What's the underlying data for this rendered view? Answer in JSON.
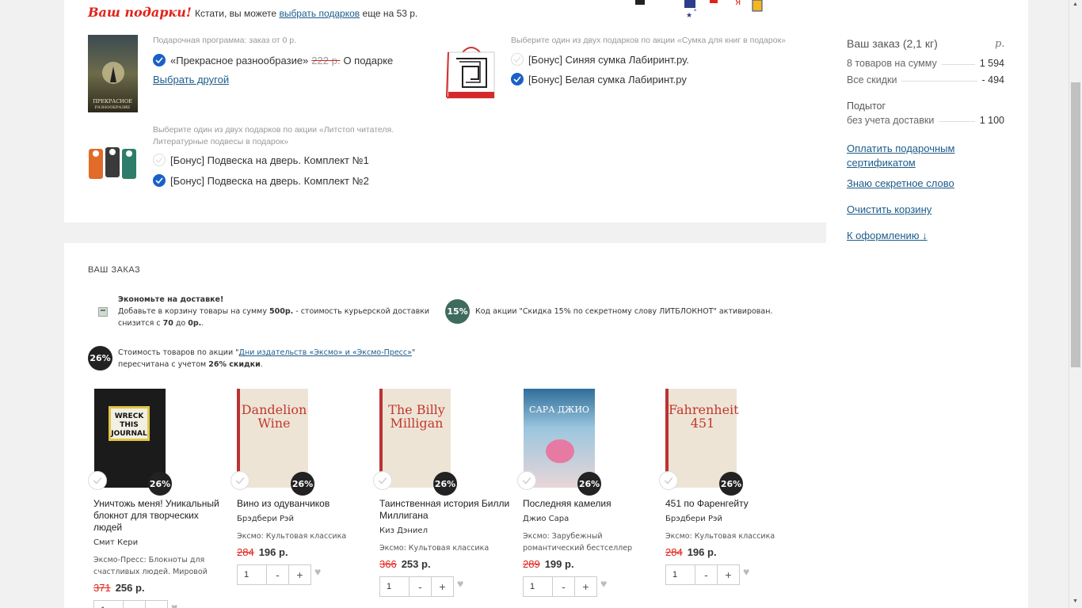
{
  "gifts": {
    "title": "Ваш подарки!",
    "note_prefix": "Кстати, вы можете",
    "note_link": "выбрать подарков",
    "note_suffix": "еще на 53 р.",
    "program": {
      "caption": "Подарочная программа: заказ от 0 р.",
      "item_title": "«Прекрасное разнообразие»",
      "old_price": "222 р.",
      "about_link": "О подарке",
      "choose_other": "Выбрать другой",
      "cover_title": "ПРЕКРАСНОЕ РАЗНООБРАЗИЕ"
    },
    "bag": {
      "caption": "Выберите один из двух подарков по акции «Сумка для книг в подарок»",
      "options": [
        "[Бонус] Синяя сумка Лабиринт.ру.",
        "[Бонус] Белая сумка Лабиринт.ру"
      ]
    },
    "hangers": {
      "caption_line1": "Выберите один из двух подарков по акции «Литстоп читателя.",
      "caption_line2": "Литературные подвесы в подарок»",
      "options": [
        "[Бонус] Подвеска на дверь. Комплект №1",
        "[Бонус] Подвеска на дверь. Комплект №2"
      ]
    }
  },
  "sidebar": {
    "title": "Ваш заказ (2,1 кг)",
    "currency": "р.",
    "rows": [
      {
        "label": "8 товаров на сумму",
        "value": "1 594"
      },
      {
        "label": "Все скидки",
        "value": "- 494"
      }
    ],
    "subtotal_line1": "Подытог",
    "subtotal_line2": "без учета доставки",
    "subtotal_value": "1 100",
    "links": {
      "gift_cert": "Оплатить подарочным сертификатом",
      "secret_word": "Знаю секретное слово",
      "clear_cart": "Очистить корзину",
      "checkout": "К оформлению ↓"
    }
  },
  "order": {
    "heading": "ВАШ ЗАКАЗ",
    "delivery": {
      "title": "Экономьте на доставке!",
      "line1_a": "Добавьте в корзину товары на сумму ",
      "line1_b": "500р.",
      "line1_c": " - стоимость курьерской доставки",
      "line2_a": "снизится с ",
      "line2_b": "70",
      "line2_c": " до ",
      "line2_d": "0р."
    },
    "code": {
      "badge": "15%",
      "text": "Код акции \"Скидка 15% по секретному слову ЛИТБЛОКНОТ\" активирован."
    },
    "eksmo": {
      "badge": "26%",
      "line1_a": "Стоимость товаров по акции \"",
      "line1_link": "Дни издательств «Эксмо» и «Эксмо-Пресс»",
      "line1_b": "\"",
      "line2_a": "пересчитана с учетом ",
      "line2_b": "26% скидки",
      "line2_c": "."
    },
    "products": [
      {
        "name": "Уничтожь меня! Уникальный блокнот для творческих людей",
        "author": "Смит Кери",
        "publisher": "Эксмо-Пресс: Блокноты для счастливых людей. Мировой",
        "old_price": "371",
        "price": "256 р.",
        "qty": "1",
        "discount": "26%",
        "cover_text": "WRECK THIS JOURNAL"
      },
      {
        "name": "Вино из одуванчиков",
        "author": "Брэдбери Рэй",
        "publisher": "Эксмо: Культовая классика",
        "old_price": "284",
        "price": "196 р.",
        "qty": "1",
        "discount": "26%",
        "cover_text": "Dandelion Wine"
      },
      {
        "name": "Таинственная история Билли Миллигана",
        "author": "Киз Дэниел",
        "publisher": "Эксмо: Культовая классика",
        "old_price": "366",
        "price": "253 р.",
        "qty": "1",
        "discount": "26%",
        "cover_text": "The Billy Milligan"
      },
      {
        "name": "Последняя камелия",
        "author": "Джио Сара",
        "publisher": "Эксмо: Зарубежный романтический бестселлер",
        "old_price": "289",
        "price": "199 р.",
        "qty": "1",
        "discount": "26%",
        "cover_text": "САРА ДЖИО"
      },
      {
        "name": "451 по Фаренгейту",
        "author": "Брэдбери Рэй",
        "publisher": "Эксмо: Культовая классика",
        "old_price": "284",
        "price": "196 р.",
        "qty": "1",
        "discount": "26%",
        "cover_text": "Fahrenheit 451"
      }
    ],
    "qty_minus": "-",
    "qty_plus": "+"
  },
  "colors": {
    "accent": "#e2231a",
    "link": "#1d5c8a",
    "check": "#1a60c8",
    "code_badge": "#3f6b5f"
  }
}
